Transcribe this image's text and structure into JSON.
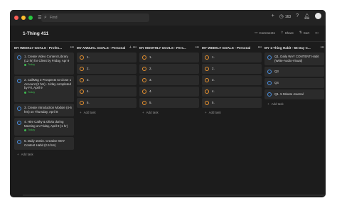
{
  "search": {
    "placeholder": "Find"
  },
  "topbar": {
    "points": "163"
  },
  "page": {
    "title": "1-Thing 411"
  },
  "header_actions": {
    "comments": "Comments",
    "share": "Share",
    "sort": "Sort"
  },
  "columns": [
    {
      "name": "MY WEEKLY GOALS - Profes...",
      "accent": "#4a90e2",
      "cards": [
        {
          "text": "1. Create Video Content Library (12 hr) for Client by Friday, Apr 9",
          "tag": "Today"
        },
        {
          "text": "2. CallMsg 3 Prospects to Close 1 Account (2 hrs) - 1/day completed by Fri, April 9",
          "tag": "Today"
        },
        {
          "text": "3. Create Introduction Module (4-6 hrs) on Thursday, April 8",
          "tag": ""
        },
        {
          "text": "4. Hire Cathy & Olivia during Meeting on Friday, April 9 (1 hr)",
          "tag": "Today"
        },
        {
          "text": "5. Daily 15min. Creative WAY Content Habit (2.5 hrs)",
          "tag": ""
        }
      ],
      "add": "Add task"
    },
    {
      "name": "MY ANNUAL GOALS - Personal",
      "accent": "#e8922f",
      "cards": [
        {
          "text": "1."
        },
        {
          "text": "2."
        },
        {
          "text": "3."
        },
        {
          "text": "4."
        },
        {
          "text": "5."
        }
      ],
      "add": "Add task"
    },
    {
      "name": "MY MONTHLY GOALS - Pers...",
      "accent": "#e8922f",
      "cards": [
        {
          "text": "1."
        },
        {
          "text": "2."
        },
        {
          "text": "3."
        },
        {
          "text": "4."
        },
        {
          "text": "5."
        }
      ],
      "add": "Add task"
    },
    {
      "name": "MY WEEKLY GOALS - Personal",
      "accent": "#e8922f",
      "cards": [
        {
          "text": "1."
        },
        {
          "text": "2."
        },
        {
          "text": "3."
        },
        {
          "text": "4."
        },
        {
          "text": "5."
        }
      ],
      "add": "Add task"
    },
    {
      "name": "MY 1-Thing Habit - 66 Day C...",
      "accent": "#4a90e2",
      "cards": [
        {
          "text": "Q1. Daily WAY CONTENT Habit (Write-Audio-Visual)"
        },
        {
          "text": "Q3"
        },
        {
          "text": "Q4"
        },
        {
          "text": "Q1. 5 Minute Journal"
        }
      ],
      "add": "Add task"
    }
  ]
}
